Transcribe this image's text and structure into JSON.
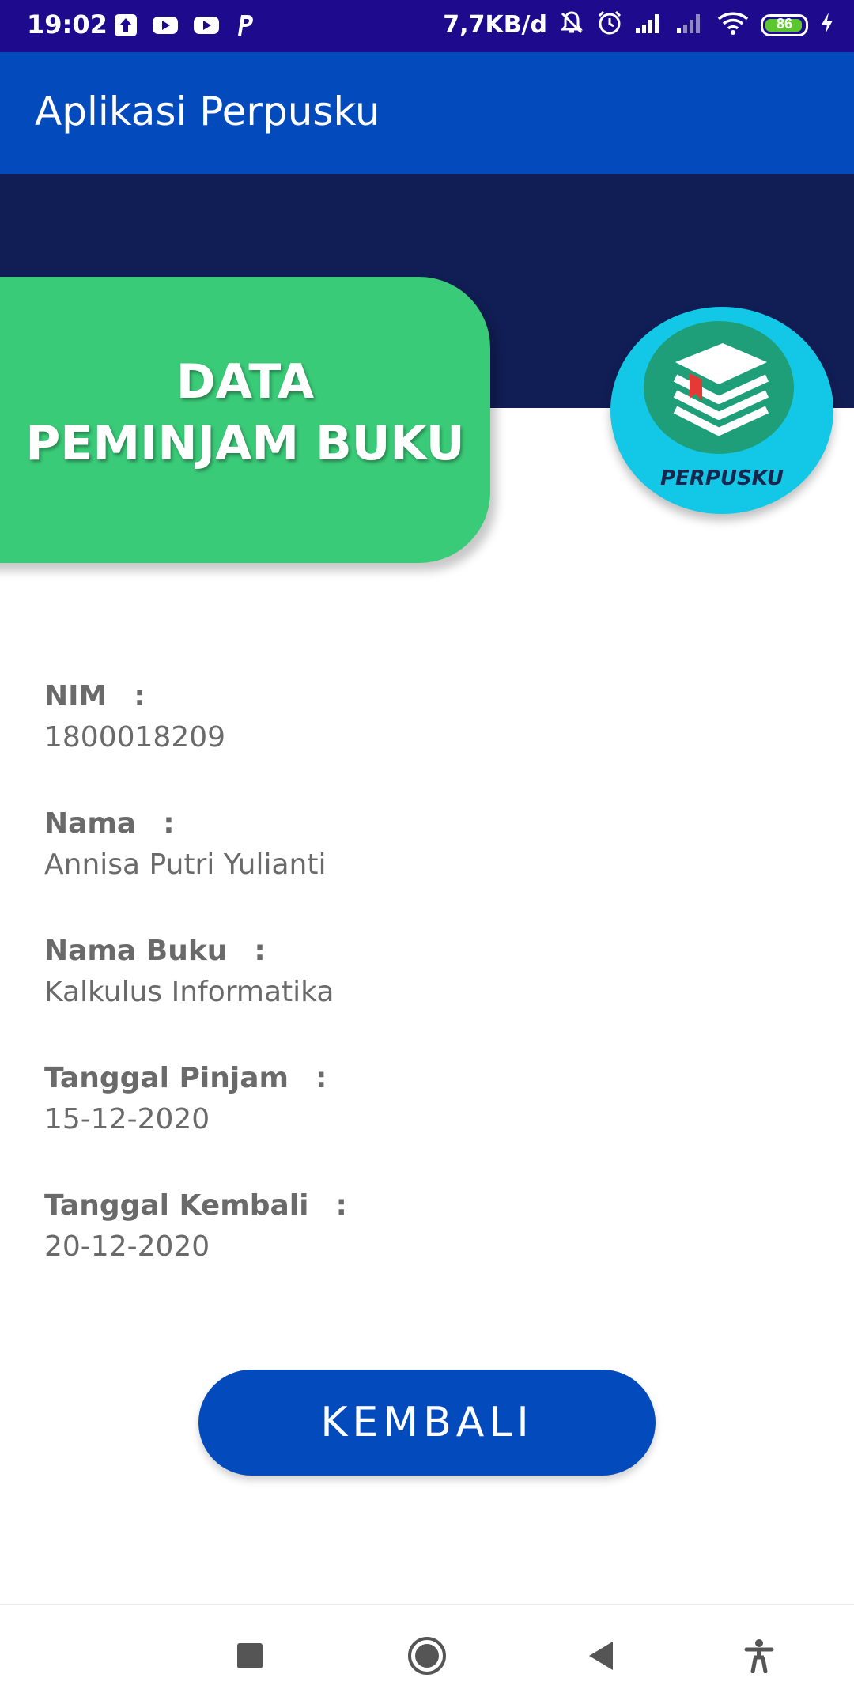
{
  "status_bar": {
    "time": "19:02",
    "network_speed": "7,7KB/d",
    "battery_level": "86",
    "icons": [
      "upload-icon",
      "youtube-icon",
      "youtube-icon",
      "paypal-icon",
      "mute-icon",
      "alarm-icon",
      "signal-icon",
      "signal-icon",
      "wifi-icon",
      "battery-icon",
      "charging-icon"
    ]
  },
  "app_bar": {
    "title": "Aplikasi Perpusku"
  },
  "header": {
    "title": "DATA\nPEMINJAM BUKU",
    "logo_text": "PERPUSKU",
    "logo_icon": "books-icon"
  },
  "details": [
    {
      "label": "NIM",
      "colon": ":",
      "value": "1800018209"
    },
    {
      "label": "Nama",
      "colon": ":",
      "value": "Annisa Putri Yulianti"
    },
    {
      "label": "Nama Buku",
      "colon": ":",
      "value": "Kalkulus Informatika"
    },
    {
      "label": "Tanggal Pinjam",
      "colon": ":",
      "value": "15-12-2020"
    },
    {
      "label": "Tanggal Kembali",
      "colon": ":",
      "value": "20-12-2020"
    }
  ],
  "button": {
    "label": "KEMBALI"
  },
  "nav_bar": {
    "icons": [
      "recents-icon",
      "home-icon",
      "back-icon",
      "accessibility-icon"
    ]
  },
  "colors": {
    "status_bar": "#1d0a8c",
    "app_bar": "#034bbd",
    "banner": "#111d55",
    "green_card": "#3acb78",
    "logo_circle": "#12c8e6",
    "logo_inner": "#1e9f79",
    "text_gray": "#6a6a6a",
    "button": "#034bbd"
  }
}
